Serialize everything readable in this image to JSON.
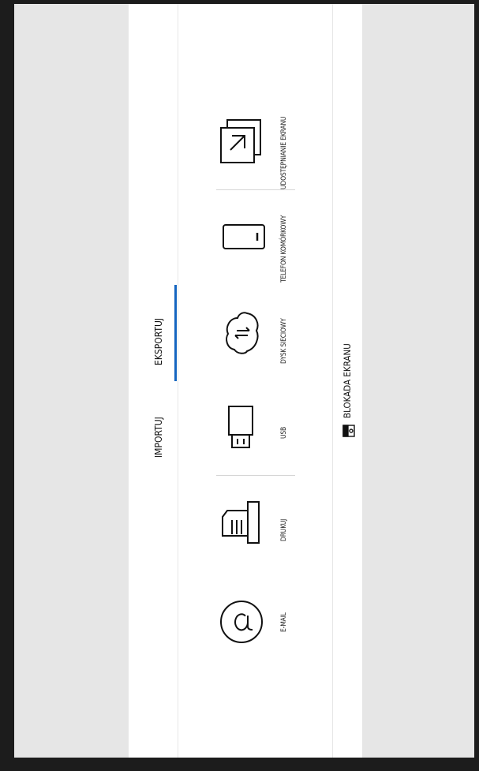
{
  "tabs": {
    "import_label": "IMPORTUJ",
    "export_label": "EKSPORTUJ",
    "active": "export"
  },
  "options": {
    "email": "E-MAIL",
    "print": "DRUKUJ",
    "usb": "USB",
    "network_drive": "DYSK SIECIOWY",
    "mobile": "TELEFON KOMÓRKOWY",
    "screen_share": "UDOSTĘPNIANIE EKRANU"
  },
  "footer": {
    "screen_lock_label": "BLOKADA EKRANU"
  },
  "colors": {
    "accent": "#1565c0",
    "panel": "#ffffff",
    "side": "#e6e6e6",
    "frame": "#1c1c1c"
  },
  "icons": [
    "email-at-icon",
    "printer-icon",
    "usb-drive-icon",
    "cloud-transfer-icon",
    "mobile-phone-icon",
    "screen-share-icon",
    "screen-lock-icon"
  ]
}
